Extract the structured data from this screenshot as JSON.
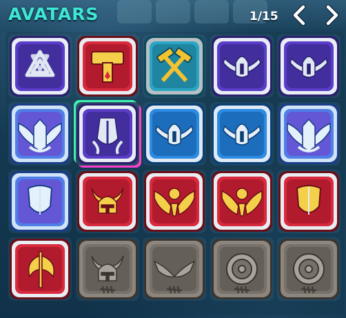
{
  "header": {
    "title": "AVATARS",
    "page_indicator": "1/15",
    "prev_icon": "chevron-left-icon",
    "next_icon": "chevron-right-icon"
  },
  "colors": {
    "title": "#3ee6d5",
    "selection_left": "#3ff0b0",
    "selection_right": "#ff3fd0"
  },
  "avatars": [
    {
      "icon": "valknut-icon",
      "theme": "purple",
      "selected": false
    },
    {
      "icon": "thor-hammer-icon",
      "theme": "red",
      "selected": false
    },
    {
      "icon": "crossed-hammers-icon",
      "theme": "teal",
      "selected": false
    },
    {
      "icon": "winged-helmet-icon",
      "theme": "purple",
      "selected": false
    },
    {
      "icon": "winged-helmet-icon",
      "theme": "purple",
      "selected": false
    },
    {
      "icon": "winged-crest-icon",
      "theme": "blue-frost",
      "selected": false
    },
    {
      "icon": "winged-shield-icon",
      "theme": "purple",
      "selected": true
    },
    {
      "icon": "winged-helmet-icon",
      "theme": "blue",
      "selected": false
    },
    {
      "icon": "winged-helmet-icon",
      "theme": "blue",
      "selected": false
    },
    {
      "icon": "winged-crest-icon",
      "theme": "blue-frost",
      "selected": false
    },
    {
      "icon": "shield-icon",
      "theme": "blue-frost",
      "selected": false
    },
    {
      "icon": "horned-helmet-icon",
      "theme": "red",
      "selected": false
    },
    {
      "icon": "winged-orb-icon",
      "theme": "red",
      "selected": false
    },
    {
      "icon": "winged-orb-icon",
      "theme": "red",
      "selected": false
    },
    {
      "icon": "shield-icon",
      "theme": "red",
      "selected": false
    },
    {
      "icon": "battle-axe-icon",
      "theme": "red",
      "selected": false
    },
    {
      "icon": "horned-helmet-icon",
      "theme": "locked",
      "selected": false
    },
    {
      "icon": "wings-icon",
      "theme": "locked",
      "selected": false
    },
    {
      "icon": "round-shield-icon",
      "theme": "locked",
      "selected": false
    },
    {
      "icon": "round-shield-icon",
      "theme": "locked",
      "selected": false
    }
  ]
}
